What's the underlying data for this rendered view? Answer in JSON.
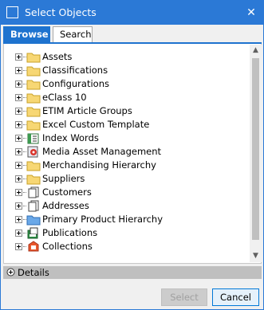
{
  "window": {
    "title": "Select Objects",
    "close_glyph": "✕",
    "accent_color": "#2b79d6"
  },
  "tabs": [
    {
      "label": "Browse",
      "active": true
    },
    {
      "label": "Search",
      "active": false
    }
  ],
  "tree": {
    "items": [
      {
        "label": "Assets",
        "icon": "folder-icon"
      },
      {
        "label": "Classifications",
        "icon": "folder-icon"
      },
      {
        "label": "Configurations",
        "icon": "folder-icon"
      },
      {
        "label": "eClass 10",
        "icon": "folder-icon"
      },
      {
        "label": "ETIM Article Groups",
        "icon": "folder-icon"
      },
      {
        "label": "Excel Custom Template",
        "icon": "folder-icon"
      },
      {
        "label": "Index Words",
        "icon": "index-words-icon"
      },
      {
        "label": "Media Asset Management",
        "icon": "media-asset-icon"
      },
      {
        "label": "Merchandising Hierarchy",
        "icon": "folder-icon"
      },
      {
        "label": "Suppliers",
        "icon": "folder-icon"
      },
      {
        "label": "Customers",
        "icon": "entity-icon"
      },
      {
        "label": "Addresses",
        "icon": "entity-icon"
      },
      {
        "label": "Primary Product Hierarchy",
        "icon": "blue-folder-icon"
      },
      {
        "label": "Publications",
        "icon": "publications-icon"
      },
      {
        "label": "Collections",
        "icon": "collections-icon"
      }
    ]
  },
  "scrollbar": {
    "up_glyph": "▲",
    "down_glyph": "▼"
  },
  "details": {
    "label": "Details"
  },
  "buttons": {
    "select_label": "Select",
    "cancel_label": "Cancel"
  }
}
